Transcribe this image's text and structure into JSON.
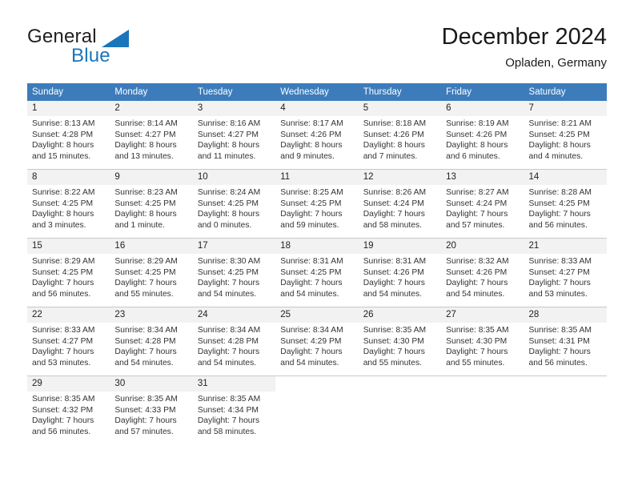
{
  "logo": {
    "word1": "General",
    "word2": "Blue",
    "triangle_color": "#1b75bb"
  },
  "header": {
    "title": "December 2024",
    "subtitle": "Opladen, Germany",
    "header_bg_color": "#3d7cbb",
    "daynum_bg_color": "#f2f2f2"
  },
  "weekdays": [
    "Sunday",
    "Monday",
    "Tuesday",
    "Wednesday",
    "Thursday",
    "Friday",
    "Saturday"
  ],
  "labels": {
    "sunrise_prefix": "Sunrise:",
    "sunset_prefix": "Sunset:",
    "daylight_prefix": "Daylight:"
  },
  "weeks": [
    [
      {
        "day": "1",
        "sunrise": "Sunrise: 8:13 AM",
        "sunset": "Sunset: 4:28 PM",
        "daylight1": "Daylight: 8 hours",
        "daylight2": "and 15 minutes."
      },
      {
        "day": "2",
        "sunrise": "Sunrise: 8:14 AM",
        "sunset": "Sunset: 4:27 PM",
        "daylight1": "Daylight: 8 hours",
        "daylight2": "and 13 minutes."
      },
      {
        "day": "3",
        "sunrise": "Sunrise: 8:16 AM",
        "sunset": "Sunset: 4:27 PM",
        "daylight1": "Daylight: 8 hours",
        "daylight2": "and 11 minutes."
      },
      {
        "day": "4",
        "sunrise": "Sunrise: 8:17 AM",
        "sunset": "Sunset: 4:26 PM",
        "daylight1": "Daylight: 8 hours",
        "daylight2": "and 9 minutes."
      },
      {
        "day": "5",
        "sunrise": "Sunrise: 8:18 AM",
        "sunset": "Sunset: 4:26 PM",
        "daylight1": "Daylight: 8 hours",
        "daylight2": "and 7 minutes."
      },
      {
        "day": "6",
        "sunrise": "Sunrise: 8:19 AM",
        "sunset": "Sunset: 4:26 PM",
        "daylight1": "Daylight: 8 hours",
        "daylight2": "and 6 minutes."
      },
      {
        "day": "7",
        "sunrise": "Sunrise: 8:21 AM",
        "sunset": "Sunset: 4:25 PM",
        "daylight1": "Daylight: 8 hours",
        "daylight2": "and 4 minutes."
      }
    ],
    [
      {
        "day": "8",
        "sunrise": "Sunrise: 8:22 AM",
        "sunset": "Sunset: 4:25 PM",
        "daylight1": "Daylight: 8 hours",
        "daylight2": "and 3 minutes."
      },
      {
        "day": "9",
        "sunrise": "Sunrise: 8:23 AM",
        "sunset": "Sunset: 4:25 PM",
        "daylight1": "Daylight: 8 hours",
        "daylight2": "and 1 minute."
      },
      {
        "day": "10",
        "sunrise": "Sunrise: 8:24 AM",
        "sunset": "Sunset: 4:25 PM",
        "daylight1": "Daylight: 8 hours",
        "daylight2": "and 0 minutes."
      },
      {
        "day": "11",
        "sunrise": "Sunrise: 8:25 AM",
        "sunset": "Sunset: 4:25 PM",
        "daylight1": "Daylight: 7 hours",
        "daylight2": "and 59 minutes."
      },
      {
        "day": "12",
        "sunrise": "Sunrise: 8:26 AM",
        "sunset": "Sunset: 4:24 PM",
        "daylight1": "Daylight: 7 hours",
        "daylight2": "and 58 minutes."
      },
      {
        "day": "13",
        "sunrise": "Sunrise: 8:27 AM",
        "sunset": "Sunset: 4:24 PM",
        "daylight1": "Daylight: 7 hours",
        "daylight2": "and 57 minutes."
      },
      {
        "day": "14",
        "sunrise": "Sunrise: 8:28 AM",
        "sunset": "Sunset: 4:25 PM",
        "daylight1": "Daylight: 7 hours",
        "daylight2": "and 56 minutes."
      }
    ],
    [
      {
        "day": "15",
        "sunrise": "Sunrise: 8:29 AM",
        "sunset": "Sunset: 4:25 PM",
        "daylight1": "Daylight: 7 hours",
        "daylight2": "and 56 minutes."
      },
      {
        "day": "16",
        "sunrise": "Sunrise: 8:29 AM",
        "sunset": "Sunset: 4:25 PM",
        "daylight1": "Daylight: 7 hours",
        "daylight2": "and 55 minutes."
      },
      {
        "day": "17",
        "sunrise": "Sunrise: 8:30 AM",
        "sunset": "Sunset: 4:25 PM",
        "daylight1": "Daylight: 7 hours",
        "daylight2": "and 54 minutes."
      },
      {
        "day": "18",
        "sunrise": "Sunrise: 8:31 AM",
        "sunset": "Sunset: 4:25 PM",
        "daylight1": "Daylight: 7 hours",
        "daylight2": "and 54 minutes."
      },
      {
        "day": "19",
        "sunrise": "Sunrise: 8:31 AM",
        "sunset": "Sunset: 4:26 PM",
        "daylight1": "Daylight: 7 hours",
        "daylight2": "and 54 minutes."
      },
      {
        "day": "20",
        "sunrise": "Sunrise: 8:32 AM",
        "sunset": "Sunset: 4:26 PM",
        "daylight1": "Daylight: 7 hours",
        "daylight2": "and 54 minutes."
      },
      {
        "day": "21",
        "sunrise": "Sunrise: 8:33 AM",
        "sunset": "Sunset: 4:27 PM",
        "daylight1": "Daylight: 7 hours",
        "daylight2": "and 53 minutes."
      }
    ],
    [
      {
        "day": "22",
        "sunrise": "Sunrise: 8:33 AM",
        "sunset": "Sunset: 4:27 PM",
        "daylight1": "Daylight: 7 hours",
        "daylight2": "and 53 minutes."
      },
      {
        "day": "23",
        "sunrise": "Sunrise: 8:34 AM",
        "sunset": "Sunset: 4:28 PM",
        "daylight1": "Daylight: 7 hours",
        "daylight2": "and 54 minutes."
      },
      {
        "day": "24",
        "sunrise": "Sunrise: 8:34 AM",
        "sunset": "Sunset: 4:28 PM",
        "daylight1": "Daylight: 7 hours",
        "daylight2": "and 54 minutes."
      },
      {
        "day": "25",
        "sunrise": "Sunrise: 8:34 AM",
        "sunset": "Sunset: 4:29 PM",
        "daylight1": "Daylight: 7 hours",
        "daylight2": "and 54 minutes."
      },
      {
        "day": "26",
        "sunrise": "Sunrise: 8:35 AM",
        "sunset": "Sunset: 4:30 PM",
        "daylight1": "Daylight: 7 hours",
        "daylight2": "and 55 minutes."
      },
      {
        "day": "27",
        "sunrise": "Sunrise: 8:35 AM",
        "sunset": "Sunset: 4:30 PM",
        "daylight1": "Daylight: 7 hours",
        "daylight2": "and 55 minutes."
      },
      {
        "day": "28",
        "sunrise": "Sunrise: 8:35 AM",
        "sunset": "Sunset: 4:31 PM",
        "daylight1": "Daylight: 7 hours",
        "daylight2": "and 56 minutes."
      }
    ],
    [
      {
        "day": "29",
        "sunrise": "Sunrise: 8:35 AM",
        "sunset": "Sunset: 4:32 PM",
        "daylight1": "Daylight: 7 hours",
        "daylight2": "and 56 minutes."
      },
      {
        "day": "30",
        "sunrise": "Sunrise: 8:35 AM",
        "sunset": "Sunset: 4:33 PM",
        "daylight1": "Daylight: 7 hours",
        "daylight2": "and 57 minutes."
      },
      {
        "day": "31",
        "sunrise": "Sunrise: 8:35 AM",
        "sunset": "Sunset: 4:34 PM",
        "daylight1": "Daylight: 7 hours",
        "daylight2": "and 58 minutes."
      },
      {
        "day": "",
        "sunrise": "",
        "sunset": "",
        "daylight1": "",
        "daylight2": ""
      },
      {
        "day": "",
        "sunrise": "",
        "sunset": "",
        "daylight1": "",
        "daylight2": ""
      },
      {
        "day": "",
        "sunrise": "",
        "sunset": "",
        "daylight1": "",
        "daylight2": ""
      },
      {
        "day": "",
        "sunrise": "",
        "sunset": "",
        "daylight1": "",
        "daylight2": ""
      }
    ]
  ]
}
